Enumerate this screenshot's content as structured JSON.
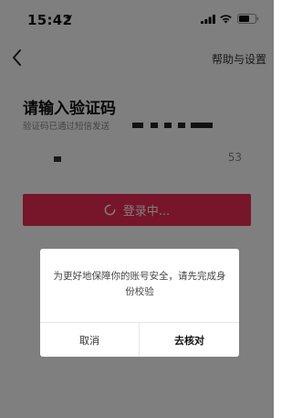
{
  "status_bar": {
    "time": "15:42"
  },
  "nav": {
    "help_settings": "帮助与设置"
  },
  "login": {
    "title": "请输入验证码",
    "sms_notice": "验证码已通过短信发送",
    "countdown": "53",
    "button_label": "登录中..."
  },
  "dialog": {
    "message": "为更好地保障你的账号安全，请先完成身份校验",
    "cancel_label": "取消",
    "verify_label": "去核对"
  },
  "colors": {
    "accent": "#ee2a55",
    "overlay": "rgba(0,0,0,0.5)"
  },
  "icons": [
    "location-arrow-icon",
    "signal-icon",
    "wifi-icon",
    "battery-icon",
    "back-icon",
    "spinner-icon"
  ]
}
